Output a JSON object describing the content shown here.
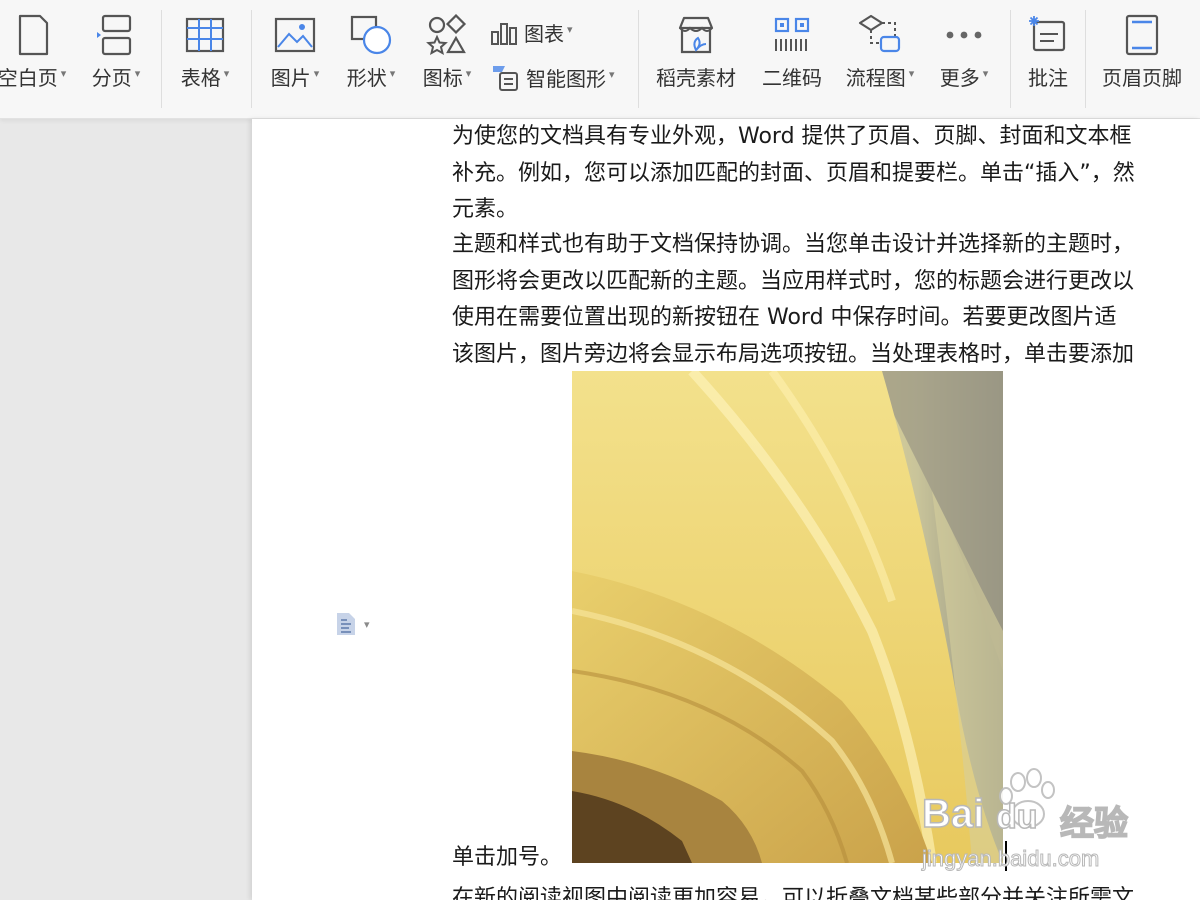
{
  "toolbar": {
    "items": {
      "blank_page": "空白页",
      "page_break": "分页",
      "table": "表格",
      "picture": "图片",
      "shape": "形状",
      "icon": "图标",
      "chart": "图表",
      "smart_art": "智能图形",
      "daoke_material": "稻壳素材",
      "qr_code": "二维码",
      "flowchart": "流程图",
      "more": "更多",
      "comment": "批注",
      "header_footer": "页眉页脚"
    },
    "caret_glyph": "▾",
    "icon_color": "#555555",
    "accent": "#4a86e8"
  },
  "document": {
    "paragraph1": [
      "为使您的文档具有专业外观，Word 提供了页眉、页脚、封面和文本框",
      "补充。例如，您可以添加匹配的封面、页眉和提要栏。单击“插入”，然",
      "元素。"
    ],
    "paragraph2": [
      "主题和样式也有助于文档保持协调。当您单击设计并选择新的主题时，",
      "图形将会更改以匹配新的主题。当应用样式时，您的标题会进行更改以",
      "使用在需要位置出现的新按钮在 Word 中保存时间。若要更改图片适",
      "该图片，图片旁边将会显示布局选项按钮。当处理表格时，单击要添加"
    ],
    "image_caption": "单击加号。",
    "paragraph3": "在新的阅读视图中阅读更加容易，可以折叠文档某些部分并关注所需文",
    "image_description": "yellow fabric close-up",
    "watermark": {
      "brand": "Bai",
      "brand2": "du",
      "brand_cn": "经验",
      "url": "jingyan.baidu.com"
    }
  }
}
